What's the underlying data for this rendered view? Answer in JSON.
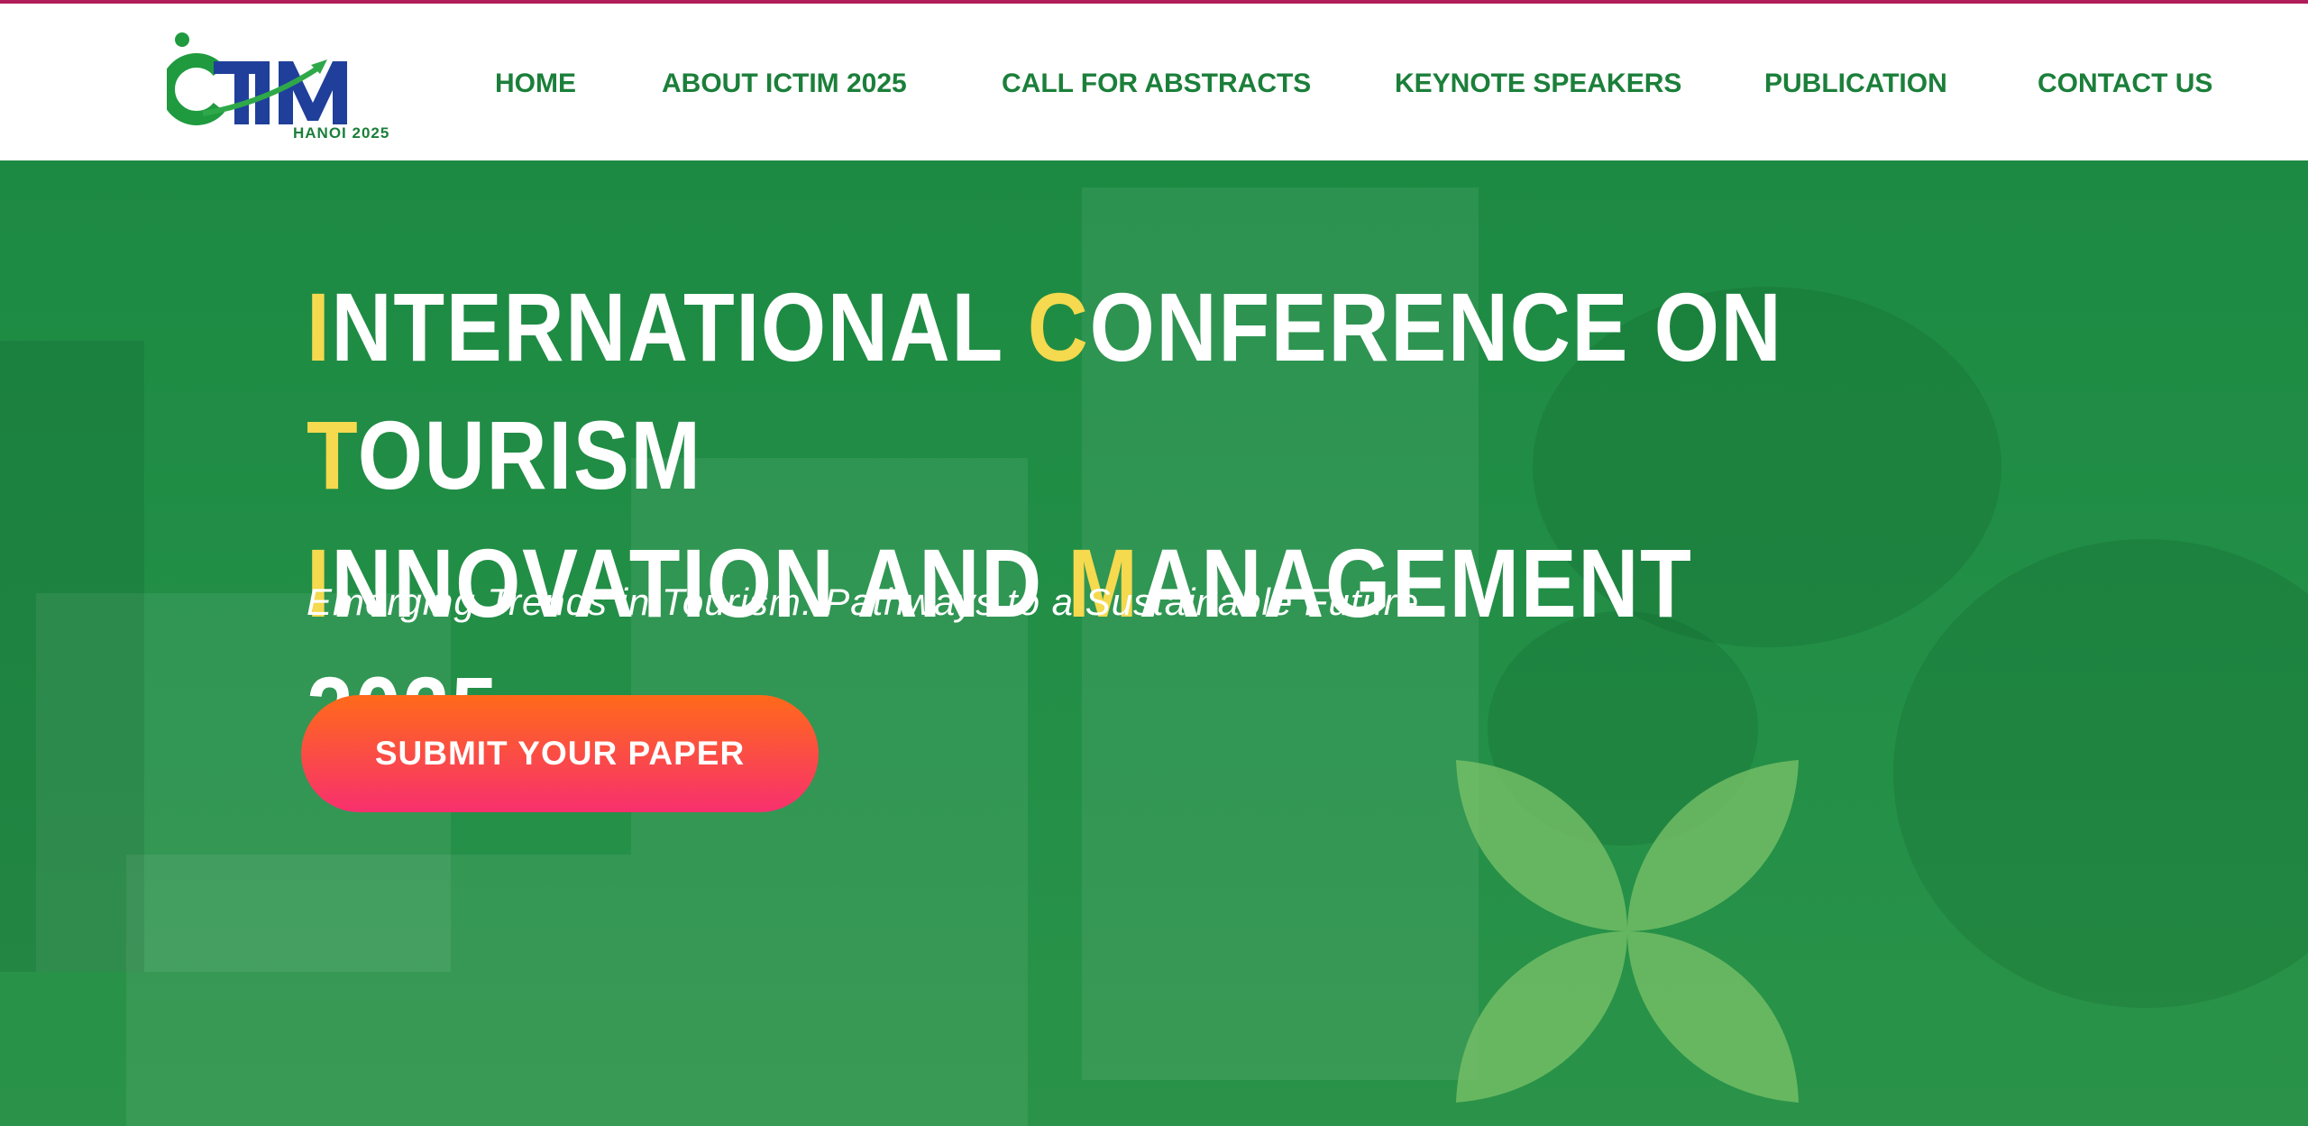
{
  "logo": {
    "letters": "ICTIM",
    "sub": "HANOI 2025"
  },
  "nav": {
    "items": [
      {
        "label": "HOME"
      },
      {
        "label": "ABOUT ICTIM 2025"
      },
      {
        "label": "CALL FOR ABSTRACTS"
      },
      {
        "label": "KEYNOTE SPEAKERS"
      },
      {
        "label": "PUBLICATION"
      },
      {
        "label": "CONTACT US"
      }
    ]
  },
  "hero": {
    "title_line1": {
      "a_hl": "I",
      "a": "NTERNATIONAL ",
      "b_hl": "C",
      "b": "ONFERENCE ON ",
      "c_hl": "T",
      "c": "OURISM"
    },
    "title_line2": {
      "a_hl": "I",
      "a": "NNOVATION AND ",
      "b_hl": "M",
      "b": "ANAGEMENT 2025"
    },
    "subtitle": "Emerging Trends in Tourism: Pathways to a Sustainable Future",
    "cta_label": "SUBMIT YOUR PAPER"
  },
  "colors": {
    "brand_green": "#1b7f3a",
    "hero_green": "#1f8f44",
    "highlight": "#f5d94e",
    "cta_start": "#ff6a1a",
    "cta_end": "#f7306e",
    "top_line": "#b01d58"
  },
  "icons": [
    "leaf-clover-icon"
  ]
}
